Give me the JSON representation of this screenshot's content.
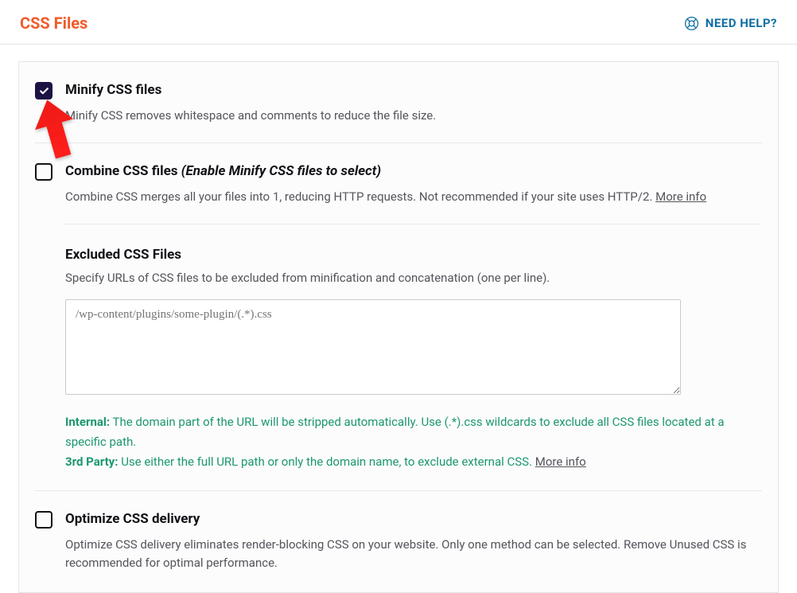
{
  "header": {
    "title": "CSS Files",
    "help": "NEED HELP?"
  },
  "settings": {
    "minify": {
      "title": "Minify CSS files",
      "desc": "Minify CSS removes whitespace and comments to reduce the file size."
    },
    "combine": {
      "title": "Combine CSS files",
      "hint": "(Enable Minify CSS files to select)",
      "desc": "Combine CSS merges all your files into 1, reducing HTTP requests. Not recommended if your site uses HTTP/2.",
      "more": "More info"
    },
    "excluded": {
      "title": "Excluded CSS Files",
      "desc": "Specify URLs of CSS files to be excluded from minification and concatenation (one per line).",
      "placeholder": "/wp-content/plugins/some-plugin/(.*).css",
      "notes": {
        "internal_label": "Internal:",
        "internal_text": " The domain part of the URL will be stripped automatically. Use (.*).css wildcards to exclude all CSS files located at a specific path.",
        "third_label": "3rd Party:",
        "third_text": " Use either the full URL path or only the domain name, to exclude external CSS. ",
        "more": "More info"
      }
    },
    "optimize": {
      "title": "Optimize CSS delivery",
      "desc": "Optimize CSS delivery eliminates render-blocking CSS on your website. Only one method can be selected. Remove Unused CSS is recommended for optimal performance."
    }
  }
}
